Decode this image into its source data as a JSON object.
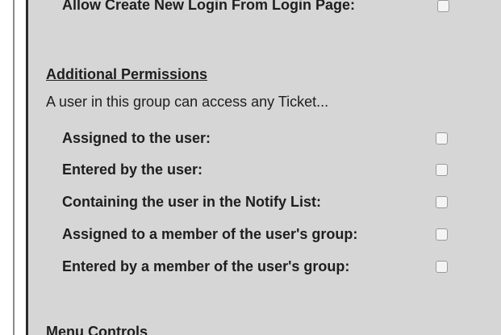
{
  "top_row": {
    "label": "Allow Create New Login From Login Page:"
  },
  "additional_permissions": {
    "heading": "Additional Permissions",
    "description": "A user in this group can access any Ticket...",
    "items": [
      {
        "label": "Assigned to the user:",
        "checked": false
      },
      {
        "label": "Entered by the user:",
        "checked": false
      },
      {
        "label": "Containing the user in the Notify List:",
        "checked": false
      },
      {
        "label": "Assigned to a member of the user's group:",
        "checked": false
      },
      {
        "label": "Entered by a member of the user's group:",
        "checked": false
      }
    ]
  },
  "next_section": {
    "heading": "Menu Controls"
  }
}
